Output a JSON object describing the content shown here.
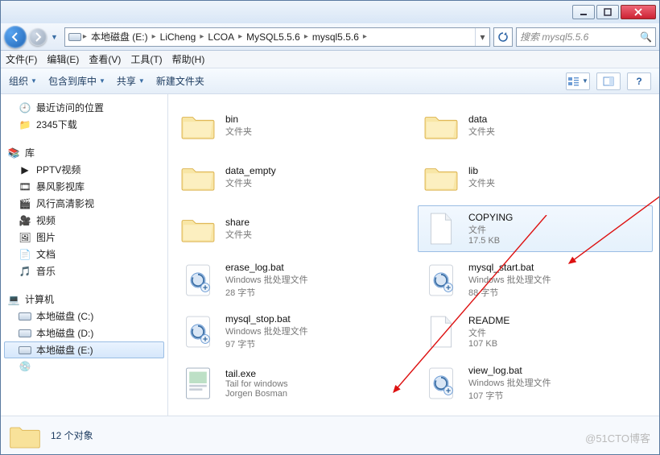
{
  "title_buttons": {
    "min": "",
    "max": "",
    "close": ""
  },
  "breadcrumb": {
    "drive_icon": "disk",
    "segs": [
      "本地磁盘 (E:)",
      "LiCheng",
      "LCOA",
      "MySQL5.5.6",
      "mysql5.5.6"
    ]
  },
  "search": {
    "placeholder": "搜索 mysql5.5.6"
  },
  "menubar": [
    "文件(F)",
    "编辑(E)",
    "查看(V)",
    "工具(T)",
    "帮助(H)"
  ],
  "toolbar": {
    "org": "组织",
    "lib": "包含到库中",
    "share": "共享",
    "newf": "新建文件夹"
  },
  "tree": {
    "recent": "最近访问的位置",
    "dl2345": "2345下载",
    "lib": "库",
    "pptv": "PPTV视频",
    "baofeng": "暴风影视库",
    "fengxing": "风行高清影视",
    "video": "视频",
    "pic": "图片",
    "doc": "文档",
    "music": "音乐",
    "computer": "计算机",
    "diskC": "本地磁盘 (C:)",
    "diskD": "本地磁盘 (D:)",
    "diskE": "本地磁盘 (E:)"
  },
  "items": [
    {
      "name": "bin",
      "sub1": "文件夹",
      "sub2": "",
      "type": "folder"
    },
    {
      "name": "data",
      "sub1": "文件夹",
      "sub2": "",
      "type": "folder"
    },
    {
      "name": "data_empty",
      "sub1": "文件夹",
      "sub2": "",
      "type": "folder"
    },
    {
      "name": "lib",
      "sub1": "文件夹",
      "sub2": "",
      "type": "folder"
    },
    {
      "name": "share",
      "sub1": "文件夹",
      "sub2": "",
      "type": "folder"
    },
    {
      "name": "COPYING",
      "sub1": "文件",
      "sub2": "17.5 KB",
      "type": "file",
      "sel": true
    },
    {
      "name": "erase_log.bat",
      "sub1": "Windows 批处理文件",
      "sub2": "28 字节",
      "type": "bat"
    },
    {
      "name": "mysql_start.bat",
      "sub1": "Windows 批处理文件",
      "sub2": "88 字节",
      "type": "bat"
    },
    {
      "name": "mysql_stop.bat",
      "sub1": "Windows 批处理文件",
      "sub2": "97 字节",
      "type": "bat"
    },
    {
      "name": "README",
      "sub1": "文件",
      "sub2": "107 KB",
      "type": "file"
    },
    {
      "name": "tail.exe",
      "sub1": "Tail for windows",
      "sub2": "Jorgen Bosman",
      "type": "exe"
    },
    {
      "name": "view_log.bat",
      "sub1": "Windows 批处理文件",
      "sub2": "107 字节",
      "type": "bat"
    }
  ],
  "status": {
    "count": "12 个对象"
  },
  "watermark": "@51CTO博客"
}
